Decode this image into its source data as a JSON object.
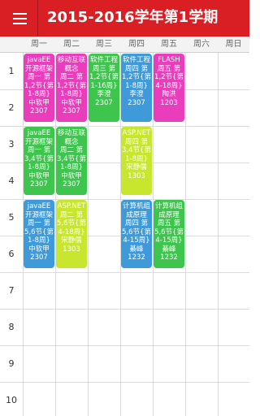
{
  "app": {
    "title": "2015-2016学年第1学期"
  },
  "days": [
    "周一",
    "周二",
    "周三",
    "周四",
    "周五",
    "周六",
    "周日"
  ],
  "periods": [
    "1",
    "2",
    "3",
    "4",
    "5",
    "6",
    "7",
    "8",
    "9",
    "10"
  ],
  "colors": {
    "appbar": "#d91e24",
    "magenta": "#e93dbb",
    "green": "#3ec54d",
    "yellow": "#c9e62f",
    "blue": "#3f9ad9"
  },
  "courses": [
    {
      "name": "javaEE开源框架",
      "detail": "周一 第1,2节{第1-8周} 中软甲 2307",
      "color": "magenta"
    },
    {
      "name": "移动互联概念",
      "detail": "周二 第1,2节{第1-8周} 中软甲 2307",
      "color": "magenta"
    },
    {
      "name": "软件工程",
      "detail": "周三 第1,2节{第1-16周} 李澄 2307",
      "color": "green"
    },
    {
      "name": "软件工程",
      "detail": "周四 第1,2节{第1-8周} 李澄 2307",
      "color": "blue"
    },
    {
      "name": "FLASH",
      "detail": "周五 第1,2节{第4-18周} 陶洪 1203",
      "color": "magenta"
    },
    {
      "name": "javaEE开源框架",
      "detail": "周一 第3,4节{第1-8周} 中软甲 2307",
      "color": "green"
    },
    {
      "name": "移动互联概念",
      "detail": "周二 第3,4节{第1-8周} 中软甲 2307",
      "color": "green"
    },
    {
      "name": "ASP.NET",
      "detail": "周四 第3,4节{第1-8周} 宋静儒 1303",
      "color": "yellow"
    },
    {
      "name": "javaEE开源框架",
      "detail": "周一 第5,6节{第1-8周} 中软甲 2307",
      "color": "blue"
    },
    {
      "name": "ASP.NET",
      "detail": "周二 第5,6节{第4-18周} 宋静儒 1303",
      "color": "yellow"
    },
    {
      "name": "计算机组成原理",
      "detail": "周四 第5,6节{第4-15周} 綦峰 1232",
      "color": "blue"
    },
    {
      "name": "计算机组成原理",
      "detail": "周五 第5,6节{第4-15周} 綦峰 1232",
      "color": "green"
    }
  ]
}
